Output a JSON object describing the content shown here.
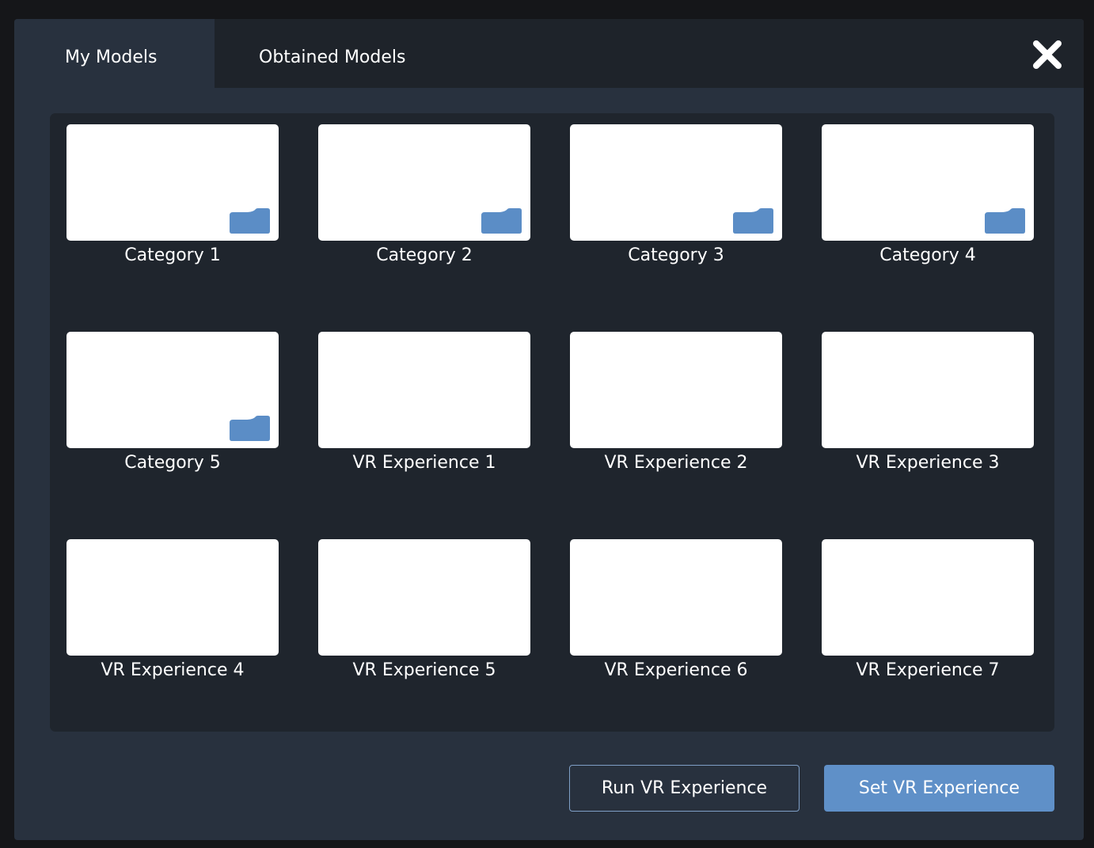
{
  "colors": {
    "folder": "#5b8dc6",
    "button_primary": "#5f90c8",
    "panel": "#28313e",
    "grid_background": "#1f252d"
  },
  "tabs": [
    {
      "label": "My Models",
      "active": true
    },
    {
      "label": "Obtained Models",
      "active": false
    }
  ],
  "close_icon": "close-icon",
  "items": [
    {
      "label": "Category 1",
      "type": "category",
      "icon": "folder-icon"
    },
    {
      "label": "Category 2",
      "type": "category",
      "icon": "folder-icon"
    },
    {
      "label": "Category 3",
      "type": "category",
      "icon": "folder-icon"
    },
    {
      "label": "Category 4",
      "type": "category",
      "icon": "folder-icon"
    },
    {
      "label": "Category 5",
      "type": "category",
      "icon": "folder-icon"
    },
    {
      "label": "VR Experience 1",
      "type": "experience"
    },
    {
      "label": "VR Experience 2",
      "type": "experience"
    },
    {
      "label": "VR Experience 3",
      "type": "experience"
    },
    {
      "label": "VR Experience 4",
      "type": "experience"
    },
    {
      "label": "VR Experience 5",
      "type": "experience"
    },
    {
      "label": "VR Experience 6",
      "type": "experience"
    },
    {
      "label": "VR Experience 7",
      "type": "experience"
    }
  ],
  "actions": {
    "run_label": "Run VR Experience",
    "set_label": "Set VR Experience"
  }
}
